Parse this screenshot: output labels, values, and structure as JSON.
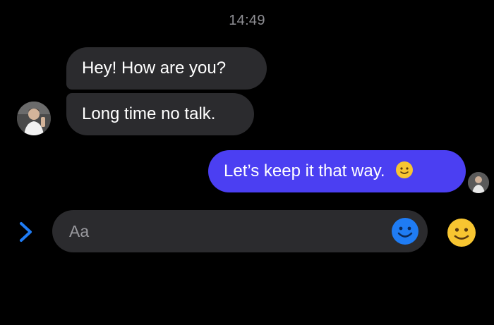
{
  "header": {
    "timestamp": "14:49"
  },
  "conversation": {
    "incoming": [
      {
        "text": "Hey! How are you?"
      },
      {
        "text": "Long time no talk."
      }
    ],
    "outgoing": [
      {
        "text": "Let’s keep it that way.",
        "emoji": "slightly-smiling-face"
      }
    ]
  },
  "composer": {
    "placeholder": "Aa",
    "expand_icon": "chevron-right-icon",
    "emoji_picker_icon": "smiley-icon",
    "quick_reaction_icon": "slightly-smiling-face-icon"
  },
  "colors": {
    "background": "#000000",
    "incoming_bubble": "#2b2b2e",
    "outgoing_bubble": "#4b3ff2",
    "accent_blue": "#1f7cf4",
    "emoji_yellow": "#f7c531"
  }
}
